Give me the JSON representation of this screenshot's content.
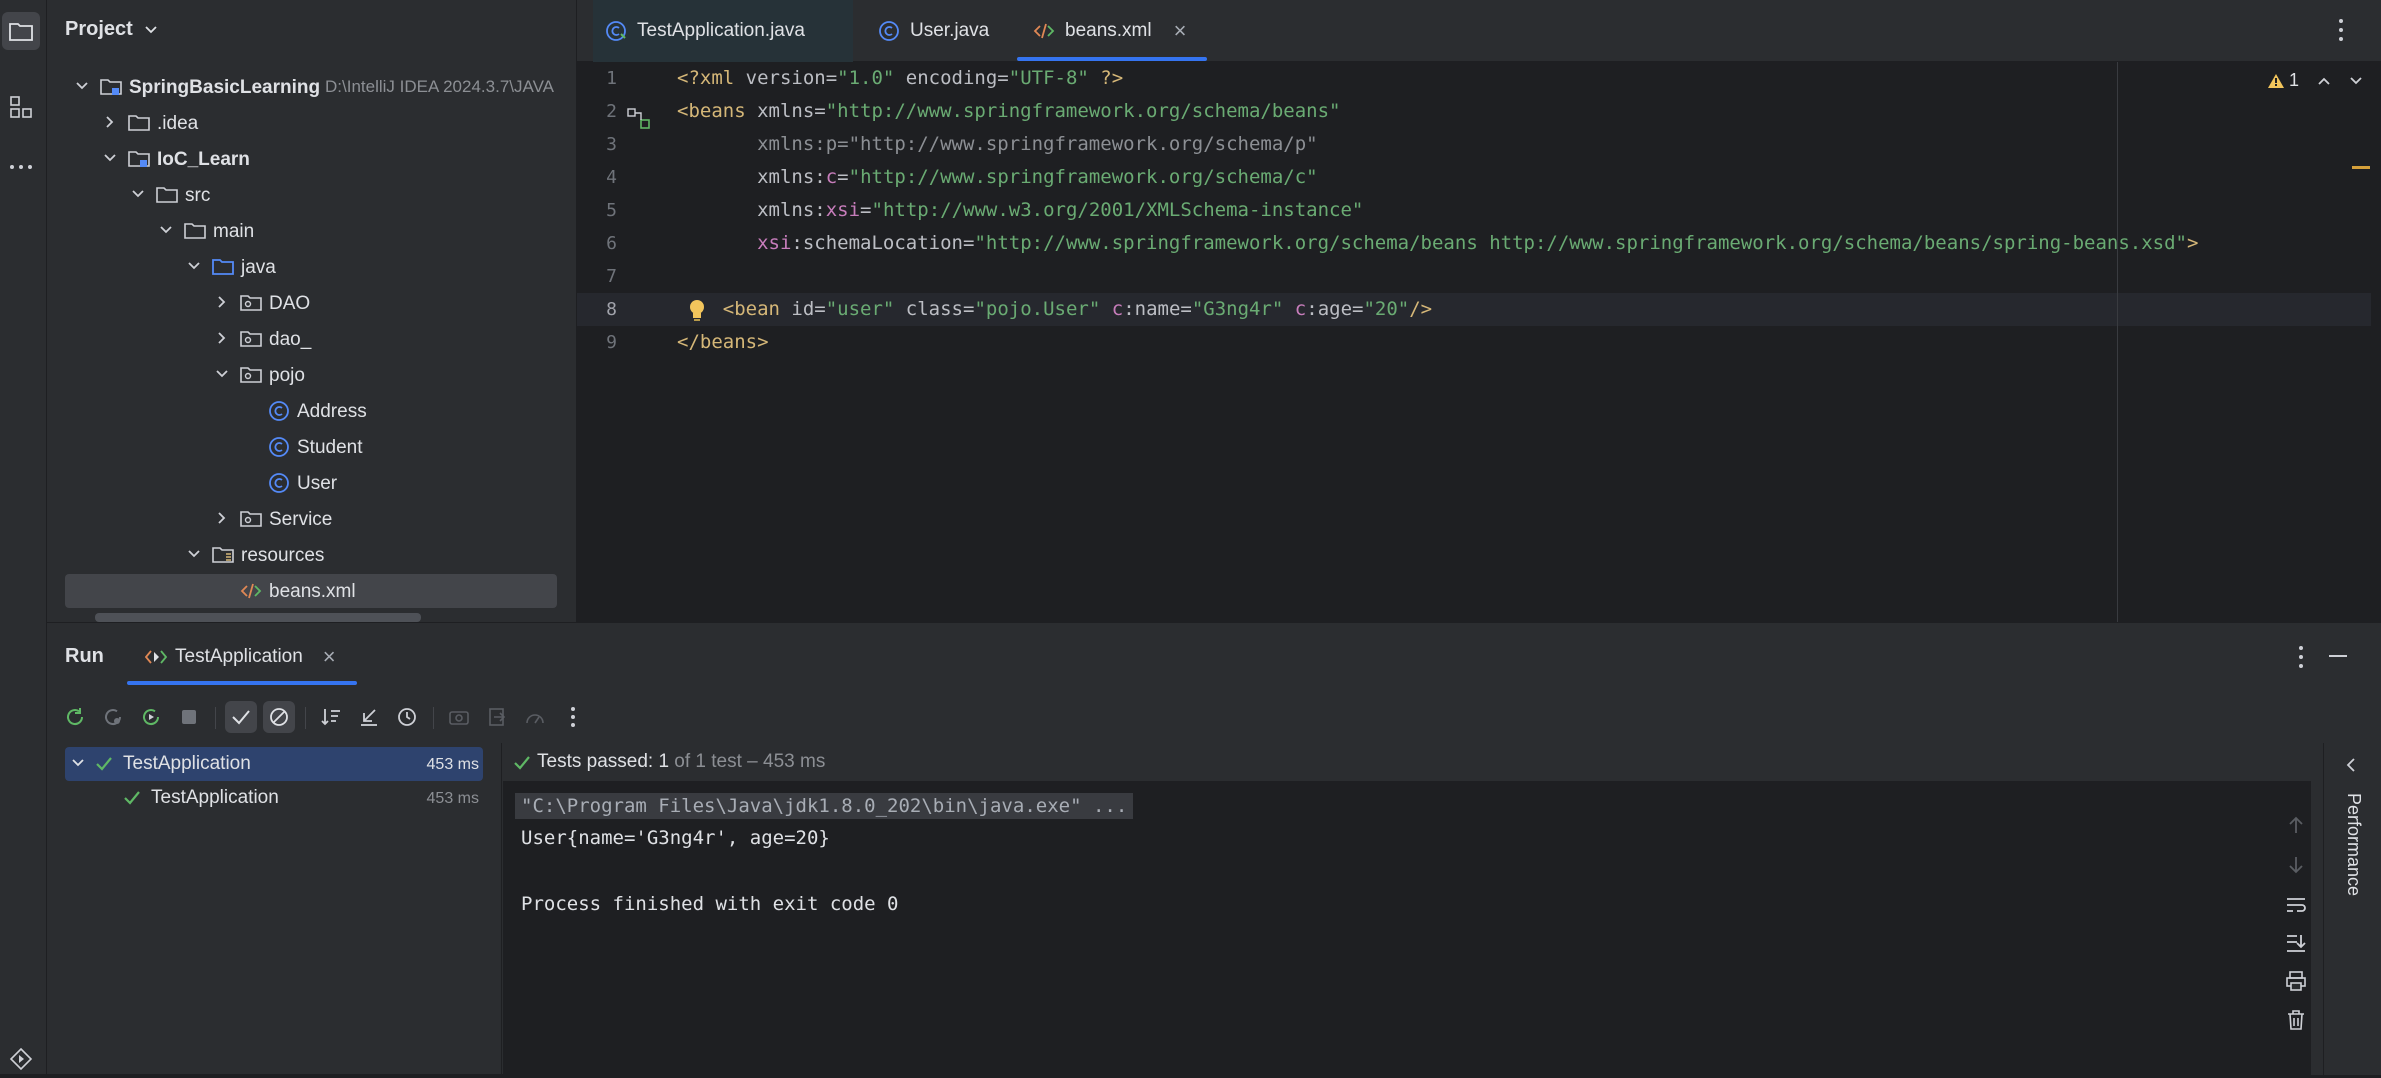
{
  "project_panel": {
    "title": "Project",
    "tree": [
      {
        "label": "SpringBasicLearning",
        "hint": "D:\\IntelliJ IDEA 2024.3.7\\JAVA",
        "depth": 0,
        "expanded": true,
        "icon": "module-folder-icon",
        "bold": true
      },
      {
        "label": ".idea",
        "depth": 1,
        "expanded": false,
        "icon": "folder-icon"
      },
      {
        "label": "IoC_Learn",
        "depth": 1,
        "expanded": true,
        "icon": "module-folder-icon",
        "bold": true
      },
      {
        "label": "src",
        "depth": 2,
        "expanded": true,
        "icon": "folder-icon"
      },
      {
        "label": "main",
        "depth": 3,
        "expanded": true,
        "icon": "folder-icon"
      },
      {
        "label": "java",
        "depth": 4,
        "expanded": true,
        "icon": "source-folder-icon"
      },
      {
        "label": "DAO",
        "depth": 5,
        "expanded": false,
        "icon": "package-icon"
      },
      {
        "label": "dao_",
        "depth": 5,
        "expanded": false,
        "icon": "package-icon"
      },
      {
        "label": "pojo",
        "depth": 5,
        "expanded": true,
        "icon": "package-icon"
      },
      {
        "label": "Address",
        "depth": 6,
        "icon": "class-icon"
      },
      {
        "label": "Student",
        "depth": 6,
        "icon": "class-icon"
      },
      {
        "label": "User",
        "depth": 6,
        "icon": "class-icon"
      },
      {
        "label": "Service",
        "depth": 5,
        "expanded": false,
        "icon": "package-icon"
      },
      {
        "label": "resources",
        "depth": 4,
        "expanded": true,
        "icon": "resources-folder-icon"
      },
      {
        "label": "beans.xml",
        "depth": 5,
        "icon": "xml-file-icon",
        "selected": true
      }
    ]
  },
  "editor": {
    "tabs": [
      {
        "label": "TestApplication.java",
        "icon": "test-class-icon"
      },
      {
        "label": "User.java",
        "icon": "class-icon"
      },
      {
        "label": "beans.xml",
        "icon": "xml-file-icon",
        "active": true,
        "close": "×"
      }
    ],
    "warning_count": "1",
    "current_line": "8",
    "lines": [
      {
        "n": "1",
        "html": [
          [
            "c-tag",
            "<?xml "
          ],
          [
            "c-attr",
            "version="
          ],
          [
            "c-str",
            "\"1.0\""
          ],
          [
            "c-attr",
            " encoding="
          ],
          [
            "c-str",
            "\"UTF-8\""
          ],
          [
            "c-tag",
            " ?>"
          ]
        ]
      },
      {
        "n": "2",
        "html": [
          [
            "c-tag",
            "<beans "
          ],
          [
            "c-attr",
            "xmlns="
          ],
          [
            "c-str",
            "\"http://www.springframework.org/schema/beans\""
          ]
        ]
      },
      {
        "n": "3",
        "html": [
          [
            "c-attr",
            "       "
          ],
          [
            "c-dim",
            "xmlns:p="
          ],
          [
            "c-dim",
            "\"http://www.springframework.org/schema/p\""
          ]
        ]
      },
      {
        "n": "4",
        "html": [
          [
            "c-attr",
            "       xmlns:"
          ],
          [
            "c-ns",
            "c"
          ],
          [
            "c-attr",
            "="
          ],
          [
            "c-str",
            "\"http://www.springframework.org/schema/c\""
          ]
        ]
      },
      {
        "n": "5",
        "html": [
          [
            "c-attr",
            "       xmlns:"
          ],
          [
            "c-ns",
            "xsi"
          ],
          [
            "c-attr",
            "="
          ],
          [
            "c-str",
            "\"http://www.w3.org/2001/XMLSchema-instance\""
          ]
        ]
      },
      {
        "n": "6",
        "html": [
          [
            "c-attr",
            "       "
          ],
          [
            "c-ns",
            "xsi"
          ],
          [
            "c-attr",
            ":schemaLocation="
          ],
          [
            "c-str",
            "\"http://www.springframework.org/schema/beans http://www.springframework.org/schema/beans/spring-beans.xsd\""
          ],
          [
            "c-tag",
            ">"
          ]
        ]
      },
      {
        "n": "7",
        "html": []
      },
      {
        "n": "8",
        "html": [
          [
            "c-tag",
            "    <bean "
          ],
          [
            "c-attr",
            "id="
          ],
          [
            "c-str",
            "\"user\""
          ],
          [
            "c-attr",
            " class="
          ],
          [
            "c-str",
            "\"pojo.User\""
          ],
          [
            "c-attr",
            " "
          ],
          [
            "c-ns",
            "c"
          ],
          [
            "c-attr",
            ":name="
          ],
          [
            "c-str",
            "\"G3ng4r\""
          ],
          [
            "c-attr",
            " "
          ],
          [
            "c-ns",
            "c"
          ],
          [
            "c-attr",
            ":age="
          ],
          [
            "c-str",
            "\"20\""
          ],
          [
            "c-tag",
            "/>"
          ]
        ]
      },
      {
        "n": "9",
        "html": [
          [
            "c-tag",
            "</beans>"
          ]
        ]
      }
    ]
  },
  "run": {
    "title": "Run",
    "config_tab": "TestApplication",
    "tests": [
      {
        "label": "TestApplication",
        "time": "453 ms",
        "selected": true
      },
      {
        "label": "TestApplication",
        "time": "453 ms"
      }
    ],
    "status_prefix": "Tests passed: ",
    "status_count": "1",
    "status_rest": " of 1 test – 453 ms",
    "console": [
      "\"C:\\Program Files\\Java\\jdk1.8.0_202\\bin\\java.exe\" ...",
      "User{name='G3ng4r', age=20}",
      "",
      "Process finished with exit code 0"
    ],
    "side_label": "Performance"
  },
  "colors": {
    "accent": "#3574f0",
    "pass": "#5fb865",
    "warning": "#f2c55c"
  }
}
